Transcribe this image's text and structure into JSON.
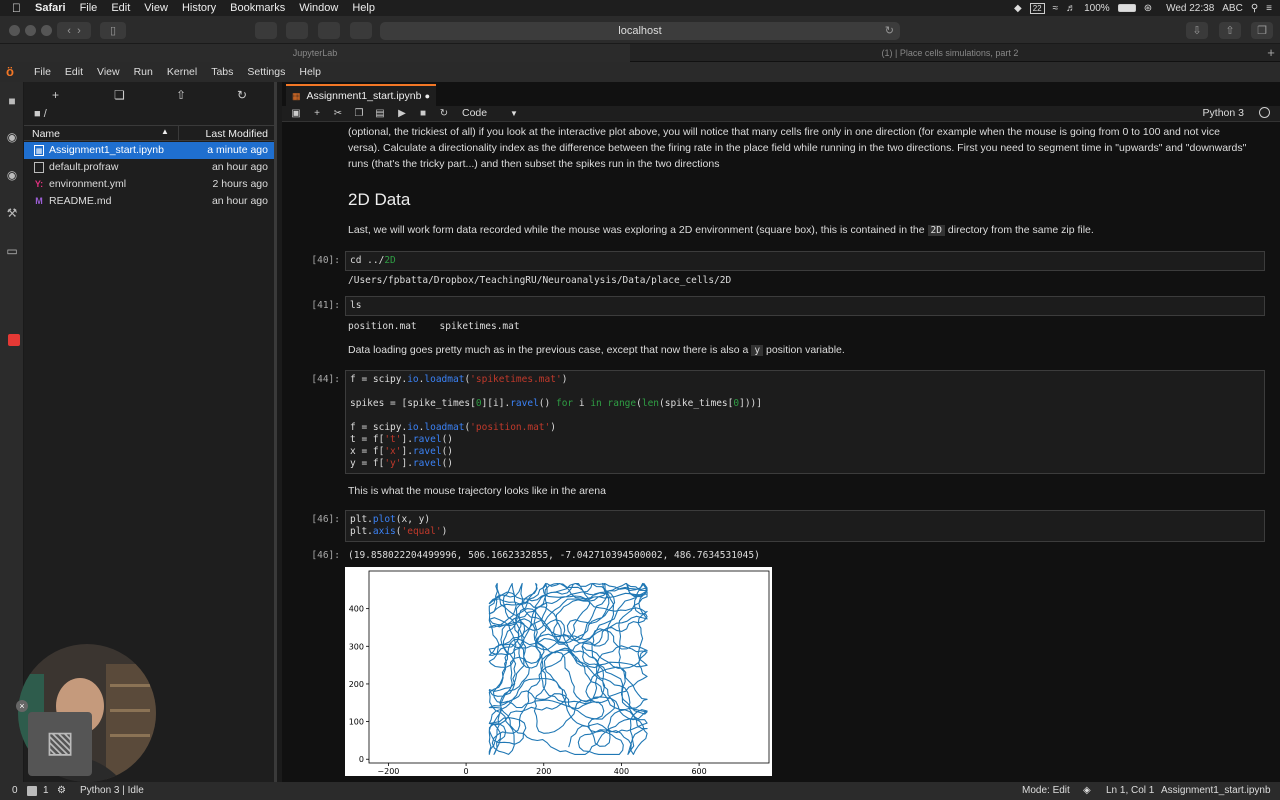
{
  "menubar": {
    "app": "Safari",
    "items": [
      "File",
      "Edit",
      "View",
      "History",
      "Bookmarks",
      "Window",
      "Help"
    ],
    "battery": "100%",
    "clock": "Wed 22:38",
    "input_source": "ABC",
    "calendar_badge": "22"
  },
  "safari": {
    "url": "localhost",
    "tabs": [
      "JupyterLab",
      "(1) | Place cells simulations, part 2"
    ]
  },
  "jupyter_menu": [
    "File",
    "Edit",
    "View",
    "Run",
    "Kernel",
    "Tabs",
    "Settings",
    "Help"
  ],
  "filebrowser": {
    "path": "/",
    "col_name": "Name",
    "col_modified": "Last Modified",
    "files": [
      {
        "name": "Assignment1_start.ipynb",
        "modified": "a minute ago",
        "icon": "notebook-icon"
      },
      {
        "name": "default.profraw",
        "modified": "an hour ago",
        "icon": "file-icon"
      },
      {
        "name": "environment.yml",
        "modified": "2 hours ago",
        "icon": "yaml-icon"
      },
      {
        "name": "README.md",
        "modified": "an hour ago",
        "icon": "markdown-icon"
      }
    ]
  },
  "notebook": {
    "tab_title": "Assignment1_start.ipynb",
    "cell_type": "Code",
    "kernel": "Python 3",
    "para_intro": [
      "(optional, the trickiest of all) if you look at the interactive plot above, you will notice that many cells fire only in one direction (for example when the mouse is going from 0 to 100 and not vice",
      "versa). Calculate a directionality index as the difference between the firing rate in the place field while running in the two directions. First you need to segment time in \"upwards\" and \"downwards\"",
      "runs (that's the tricky part...) and then subset the spikes run in the two directions"
    ],
    "heading": "2D Data",
    "para_2d_a": "Last, we will work form data recorded while the mouse was exploring a 2D environment (square box), this is contained in the",
    "para_2d_code": "2D",
    "para_2d_b": "directory from the same zip file.",
    "p40": "[40]:",
    "cell40_code": "cd ../",
    "cell40_num": "2D",
    "out40": "/Users/fpbatta/Dropbox/TeachingRU/Neuroanalysis/Data/place_cells/2D",
    "p41": "[41]:",
    "cell41": "ls",
    "out41": "position.mat    spiketimes.mat",
    "para_load_a": "Data loading goes pretty much as in the previous case, except that now there is also a",
    "para_load_code": "y",
    "para_load_b": "position variable.",
    "p44": "[44]:",
    "para_traj": "This is what the mouse trajectory looks like in the arena",
    "p46": "[46]:",
    "p46o": "[46]:",
    "out46": "(19.858022204499996, 506.1662332855, -7.042710394500002, 486.7634531045)"
  },
  "chart_data": {
    "type": "line",
    "title": "",
    "xlabel": "",
    "ylabel": "",
    "xlim": [
      -250,
      780
    ],
    "ylim": [
      -10,
      500
    ],
    "xticks": [
      -200,
      0,
      200,
      400,
      600
    ],
    "yticks": [
      0,
      100,
      200,
      300,
      400
    ],
    "series": [
      {
        "color": "#1f77b4",
        "x_range": [
          19.86,
          506.17
        ],
        "y_range": [
          -7.04,
          486.76
        ]
      }
    ]
  },
  "status": {
    "left_a": "0",
    "left_b": "1",
    "kernel_status": "Python 3 | Idle",
    "mode": "Mode: Edit",
    "position": "Ln 1, Col 1",
    "file": "Assignment1_start.ipynb"
  },
  "colors": {
    "accent": "#f37726",
    "selection": "#1f6fcf",
    "plot_line": "#1f77b4"
  }
}
